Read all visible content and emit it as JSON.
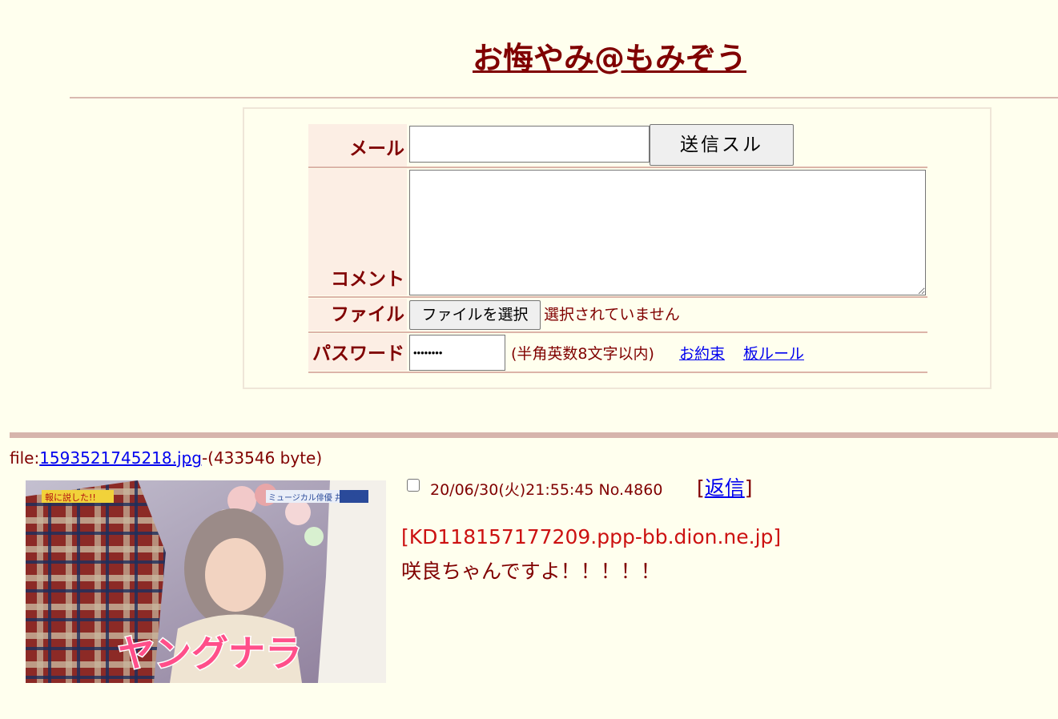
{
  "header": {
    "title": "お悔やみ@もみぞう"
  },
  "form": {
    "mail_label": "メール",
    "mail_value": "",
    "submit_label": "送信スル",
    "comment_label": "コメント",
    "comment_value": "",
    "file_label": "ファイル",
    "file_button_label": "ファイルを選択",
    "file_status": "選択されていません",
    "password_label": "パスワード",
    "password_value": "••••••••",
    "password_hint": "(半角英数8文字以内)",
    "link_rules": "お約束",
    "link_board_rules": "板ルール"
  },
  "post": {
    "file_prefix": "file:",
    "file_name": "1593521745218.jpg",
    "file_size": "-(433546 byte)",
    "date_no": "20/06/30(火)21:55:45 No.4860",
    "reply_open": "[",
    "reply_label": "返信",
    "reply_close": "]",
    "host": "[KD118157177209.ppp-bb.dion.ne.jp]",
    "message": "咲良ちゃんですよ！！！！！",
    "image_caption": "ヤングナラ",
    "image_tag_left": "報に説した!!",
    "image_tag_right": "ミュージカル俳優 井上芳雄"
  },
  "colors": {
    "background": "#ffffee",
    "text": "#800000",
    "label_bg": "#fceee4",
    "link": "#0000ee",
    "host": "#cc1111"
  }
}
